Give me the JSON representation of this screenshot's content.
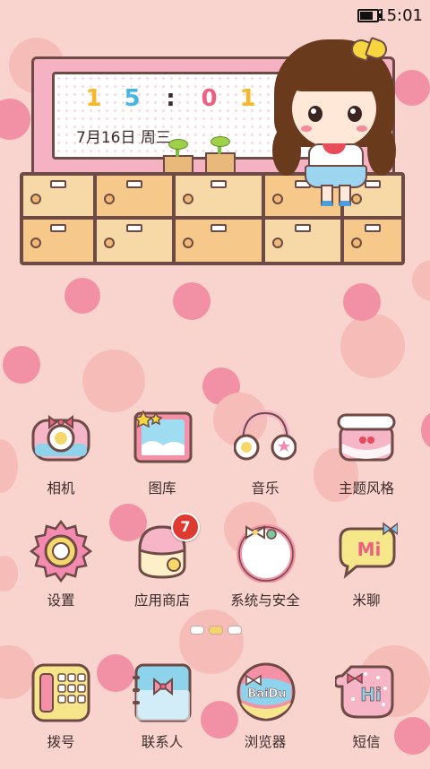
{
  "status_bar": {
    "time": "15:01",
    "battery_level": 0.9
  },
  "clock_widget": {
    "digits": [
      "1",
      "5",
      ":",
      "0",
      "1"
    ],
    "date": "7月16日 周三"
  },
  "apps": {
    "row1": [
      {
        "label": "相机",
        "icon": "camera-icon"
      },
      {
        "label": "图库",
        "icon": "gallery-icon"
      },
      {
        "label": "音乐",
        "icon": "headphones-icon"
      },
      {
        "label": "主题风格",
        "icon": "themes-icon"
      }
    ],
    "row2": [
      {
        "label": "设置",
        "icon": "gear-icon"
      },
      {
        "label": "应用商店",
        "icon": "app-store-icon",
        "badge": "7"
      },
      {
        "label": "系统与安全",
        "icon": "security-icon"
      },
      {
        "label": "米聊",
        "icon": "miliao-icon",
        "text": "Mi"
      }
    ]
  },
  "dock": [
    {
      "label": "拨号",
      "icon": "phone-icon"
    },
    {
      "label": "联系人",
      "icon": "contacts-icon"
    },
    {
      "label": "浏览器",
      "icon": "browser-icon",
      "text": "BaiDu"
    },
    {
      "label": "短信",
      "icon": "messages-icon",
      "text": "Hi"
    }
  ],
  "pager": {
    "pages": 3,
    "current": 1
  },
  "colors": {
    "background": "#f9d3cd",
    "dot_pink": "#f291a6",
    "badge": "#e03a30"
  }
}
